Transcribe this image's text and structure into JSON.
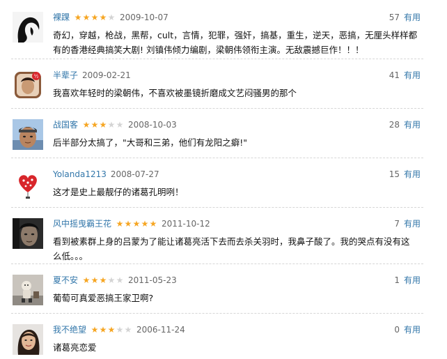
{
  "reviews": [
    {
      "user": "裸踝",
      "stars": 4,
      "date": "2009-10-07",
      "votes": "57",
      "useful_label": "有用",
      "comment": "奇幻，穿越，枪战，黑帮，cult，言情，犯罪，强奸，搞基，重生，逆天，恶搞，无厘头样样都有的香港经典搞笑大剧! 刘镇伟倾力编剧，梁朝伟领衔主演。无敌震撼巨作！！！",
      "avatar_icon": "abstract-portrait-avatar"
    },
    {
      "user": "半辈子",
      "stars": 0,
      "date": "2009-02-21",
      "votes": "41",
      "useful_label": "有用",
      "comment": "我喜欢年轻时的梁朝伟，不喜欢被墨镜折磨成文艺闷骚男的那个",
      "avatar_icon": "app-icon-portrait-avatar"
    },
    {
      "user": "战国客",
      "stars": 3,
      "date": "2008-10-03",
      "votes": "28",
      "useful_label": "有用",
      "comment": "后半部分太搞了，\"大哥和三弟，他们有龙阳之癖!\"",
      "avatar_icon": "man-headband-avatar"
    },
    {
      "user": "Yolanda1213",
      "stars": 0,
      "date": "2008-07-27",
      "votes": "15",
      "useful_label": "有用",
      "comment": "这才是史上最靓仔的诸葛孔明咧！",
      "avatar_icon": "red-heart-avatar"
    },
    {
      "user": "风中摇曳霸王花",
      "stars": 5,
      "date": "2011-10-12",
      "votes": "7",
      "useful_label": "有用",
      "comment": "看到被素群上身的吕蒙为了能让诸葛亮活下去而去杀关羽时，我鼻子酸了。我的哭点有没有这么低。。。",
      "avatar_icon": "dark-portrait-avatar"
    },
    {
      "user": "夏不安",
      "stars": 3,
      "date": "2011-05-23",
      "votes": "1",
      "useful_label": "有用",
      "comment": "葡萄可真爱恶搞王家卫啊?",
      "avatar_icon": "toy-figure-avatar"
    },
    {
      "user": "我不绝望",
      "stars": 3,
      "date": "2006-11-24",
      "votes": "0",
      "useful_label": "有用",
      "comment": "诸葛亮恋爱",
      "avatar_icon": "woman-portrait-avatar"
    }
  ]
}
